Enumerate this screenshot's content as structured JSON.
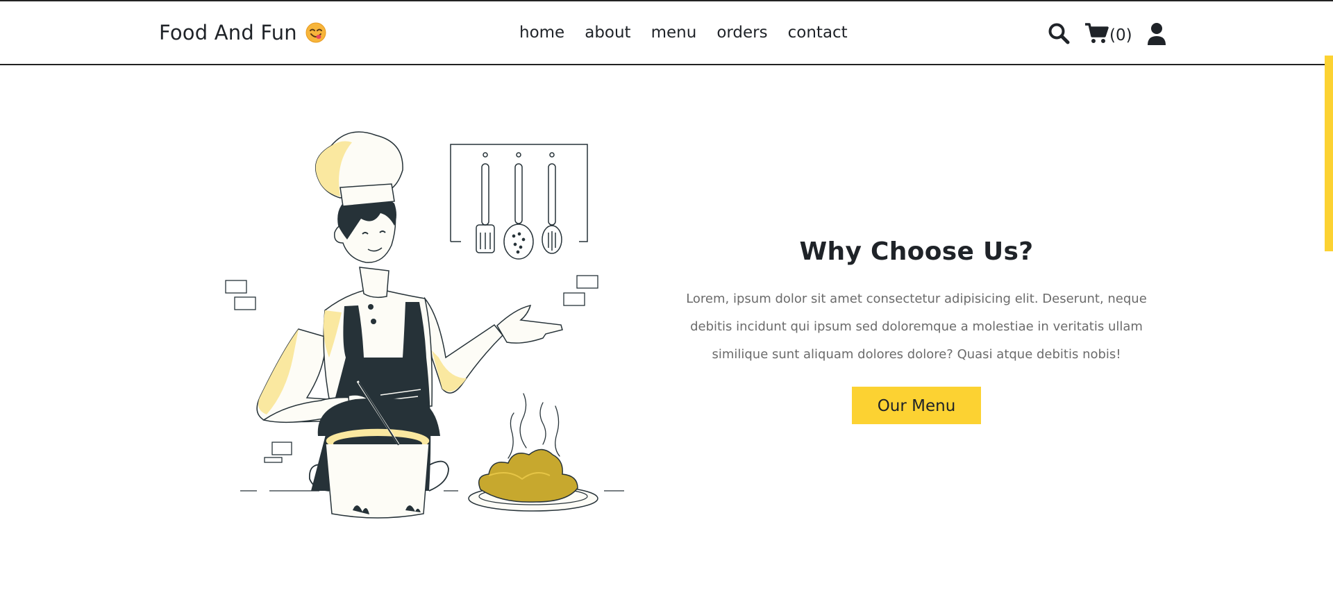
{
  "header": {
    "logo_text": "Food And Fun",
    "logo_emoji_name": "face-savoring-food-icon",
    "nav": [
      {
        "label": "home"
      },
      {
        "label": "about"
      },
      {
        "label": "menu"
      },
      {
        "label": "orders"
      },
      {
        "label": "contact"
      }
    ],
    "cart_count": "(0)",
    "icons": [
      "search-icon",
      "cart-icon",
      "user-icon"
    ]
  },
  "hero": {
    "title": "Why Choose Us?",
    "description": "Lorem, ipsum dolor sit amet consectetur adipisicing elit. Deserunt, neque debitis incidunt qui ipsum sed doloremque a molestiae in veritatis ullam similique sunt aliquam dolores dolore? Quasi atque debitis nobis!",
    "button_label": "Our Menu",
    "illustration": "chef-cooking-illustration"
  },
  "colors": {
    "accent": "#fcd232",
    "text": "#1f2328",
    "muted_text": "#6b6b6b",
    "illustration_dark": "#263238",
    "illustration_yellow": "#fae8a0",
    "food_yellow": "#c7a82e"
  }
}
